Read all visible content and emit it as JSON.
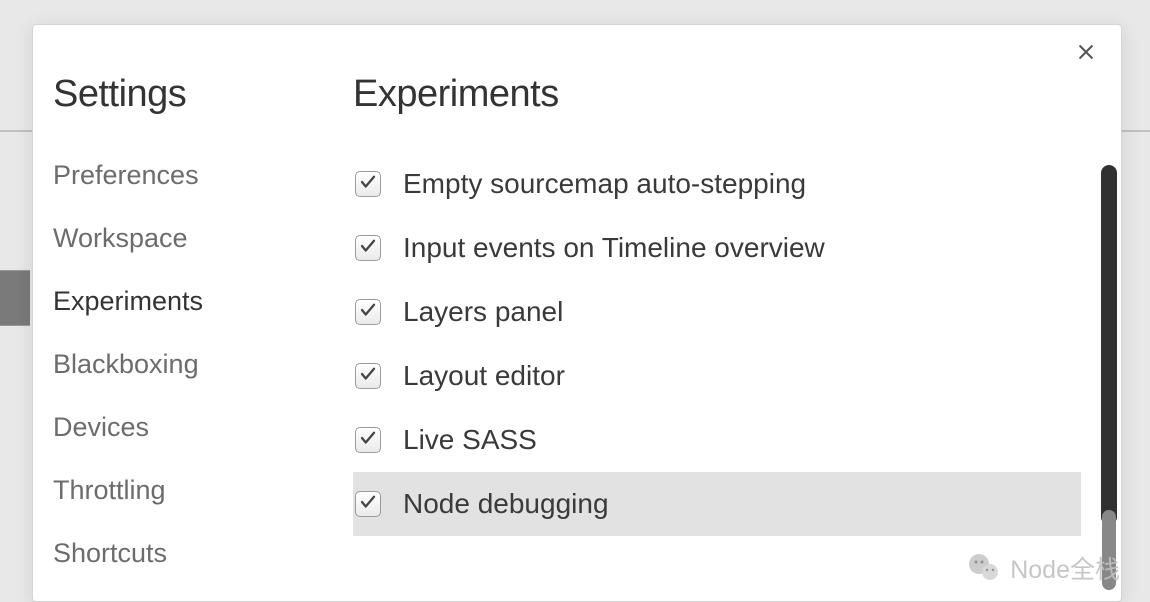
{
  "sidebar": {
    "title": "Settings",
    "items": [
      {
        "label": "Preferences",
        "active": false
      },
      {
        "label": "Workspace",
        "active": false
      },
      {
        "label": "Experiments",
        "active": true
      },
      {
        "label": "Blackboxing",
        "active": false
      },
      {
        "label": "Devices",
        "active": false
      },
      {
        "label": "Throttling",
        "active": false
      },
      {
        "label": "Shortcuts",
        "active": false
      }
    ]
  },
  "main": {
    "title": "Experiments",
    "experiments": [
      {
        "label": "Empty sourcemap auto-stepping",
        "checked": true,
        "highlighted": false
      },
      {
        "label": "Input events on Timeline overview",
        "checked": true,
        "highlighted": false
      },
      {
        "label": "Layers panel",
        "checked": true,
        "highlighted": false
      },
      {
        "label": "Layout editor",
        "checked": true,
        "highlighted": false
      },
      {
        "label": "Live SASS",
        "checked": true,
        "highlighted": false
      },
      {
        "label": "Node debugging",
        "checked": true,
        "highlighted": true
      }
    ]
  },
  "watermark": {
    "text": "Node全栈"
  }
}
